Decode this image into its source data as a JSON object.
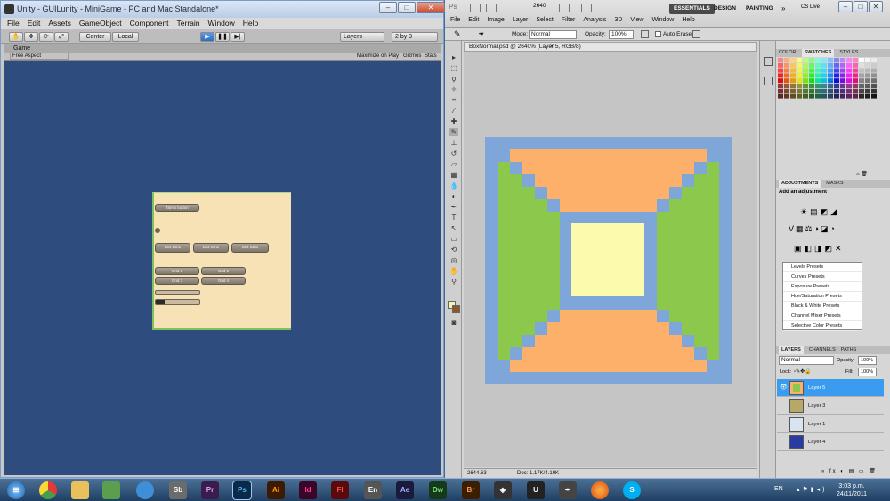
{
  "unity": {
    "title": "Unity - GUILunity - MiniGame - PC and Mac Standalone*",
    "menu": [
      "File",
      "Edit",
      "Assets",
      "GameObject",
      "Component",
      "Terrain",
      "Window",
      "Help"
    ],
    "toolbar": {
      "center": "Center",
      "local": "Local",
      "layers": "Layers",
      "layout": "2 by 3"
    },
    "game_tab": "Game",
    "aspect": "Free Aspect",
    "maximize": "Maximize on Play",
    "gizmos": "Gizmos",
    "stats": "Stats",
    "gui": {
      "top_button": "Tamix button",
      "box_buttons": [
        "Box Btn1",
        "Box Btn2",
        "Box Btn3"
      ],
      "grid_buttons": [
        "Grid 1",
        "Grid 2",
        "Grid 3",
        "Grid 4"
      ]
    }
  },
  "photoshop": {
    "logo": "Ps",
    "zoom": "2640",
    "menu": [
      "File",
      "Edit",
      "Image",
      "Layer",
      "Select",
      "Filter",
      "Analysis",
      "3D",
      "View",
      "Window",
      "Help"
    ],
    "workspaces": [
      "ESSENTIALS",
      "DESIGN",
      "PAINTING"
    ],
    "cs_live": "CS Live",
    "options": {
      "mode_label": "Mode:",
      "mode": "Normal",
      "opacity_label": "Opacity:",
      "opacity": "100%",
      "auto_erase": "Auto Erase"
    },
    "document_tab": "BoxNormal.psd @ 2640% (Layer 5, RGB/8)",
    "status_zoom": "2644.63",
    "status_doc": "Doc: 1.17K/4.19K",
    "color_tabs": [
      "COLOR",
      "SWATCHES",
      "STYLES"
    ],
    "adj_tabs": [
      "ADJUSTMENTS",
      "MASKS"
    ],
    "add_adjustment": "Add an adjustment",
    "presets": [
      "Levels Presets",
      "Curves Presets",
      "Exposure Presets",
      "Hue/Saturation Presets",
      "Black & White Presets",
      "Channel Mixer Presets",
      "Selective Color Presets"
    ],
    "layer_tabs": [
      "LAYERS",
      "CHANNELS",
      "PATHS"
    ],
    "blend": "Normal",
    "opacity_label": "Opacity:",
    "opacity": "100%",
    "lock_label": "Lock:",
    "fill_label": "Fill:",
    "fill": "100%",
    "layers": [
      "Layer 5",
      "Layer 3",
      "Layer 1",
      "Layer 4"
    ],
    "colors": {
      "blue": "#7ea6d8",
      "orange": "#fdb06a",
      "green": "#8cc84b",
      "yellow": "#fbfaad"
    }
  },
  "taskbar": {
    "apps": [
      "Sb",
      "Pr",
      "Ps",
      "Ai",
      "Id",
      "Fl",
      "En",
      "Ae",
      "Dw",
      "Br"
    ],
    "lang": "EN",
    "time": "3:03 p.m.",
    "date": "24/11/2011"
  }
}
